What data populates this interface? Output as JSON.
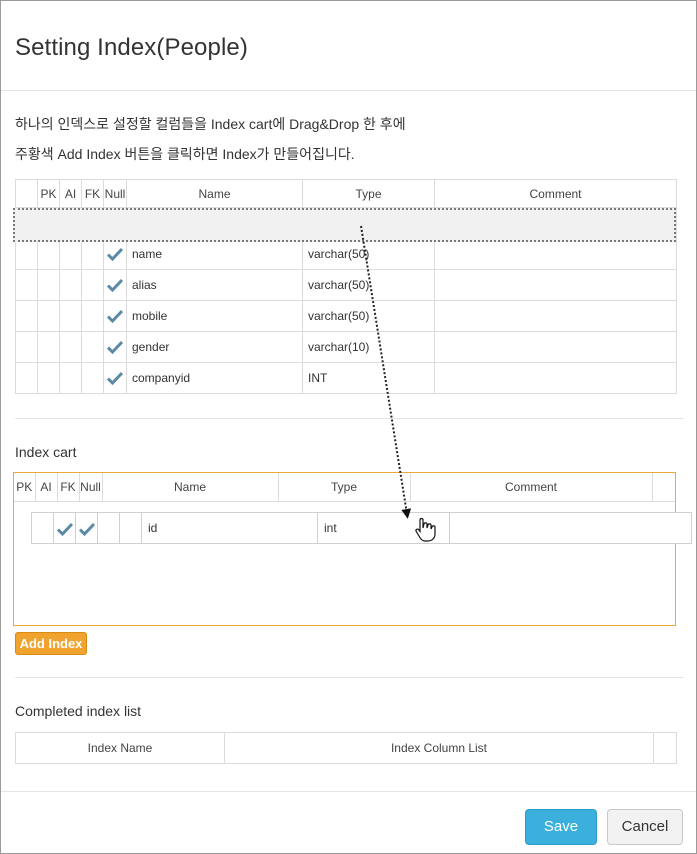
{
  "dialog": {
    "title": "Setting Index(People)",
    "instruction_line1": "하나의 인덱스로 설정할 컬럼들을 Index cart에 Drag&Drop 한 후에",
    "instruction_line2": "주황색 Add Index 버튼을 클릭하면 Index가 만들어집니다."
  },
  "columns_table": {
    "headers": [
      "",
      "PK",
      "AI",
      "FK",
      "Null",
      "Name",
      "Type",
      "Comment"
    ],
    "rows": [
      {
        "null": true,
        "name": "name",
        "type": "varchar(50)",
        "comment": ""
      },
      {
        "null": true,
        "name": "alias",
        "type": "varchar(50)",
        "comment": ""
      },
      {
        "null": true,
        "name": "mobile",
        "type": "varchar(50)",
        "comment": ""
      },
      {
        "null": true,
        "name": "gender",
        "type": "varchar(10)",
        "comment": ""
      },
      {
        "null": true,
        "name": "companyid",
        "type": "INT",
        "comment": ""
      }
    ]
  },
  "index_cart": {
    "label": "Index cart",
    "headers": [
      "PK",
      "AI",
      "FK",
      "Null",
      "Name",
      "Type",
      "Comment"
    ],
    "dragged_row": {
      "pk": false,
      "ai": true,
      "fk": true,
      "null": false,
      "name": "id",
      "type": "int",
      "comment": ""
    },
    "add_button": "Add Index"
  },
  "completed": {
    "label": "Completed index list",
    "headers": [
      "Index Name",
      "Index Column List"
    ]
  },
  "footer": {
    "save_label": "Save",
    "cancel_label": "Cancel"
  },
  "colors": {
    "check": "#5b8aa6",
    "accent_orange": "#f0a42f",
    "save_blue": "#3cb0dc"
  },
  "icons": [
    "check-icon",
    "hand-cursor-icon",
    "arrow-down-icon"
  ]
}
